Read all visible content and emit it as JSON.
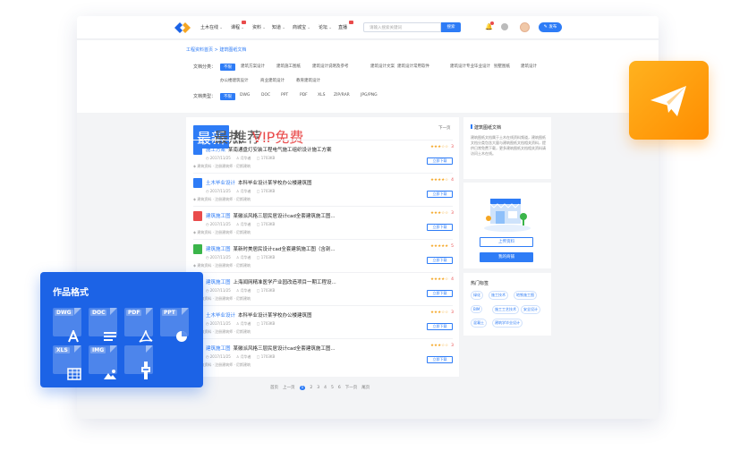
{
  "nav": {
    "items": [
      {
        "label": "土木在线",
        "chev": "⌄"
      },
      {
        "label": "课程",
        "chev": "⌄",
        "badge": true
      },
      {
        "label": "资料",
        "chev": "⌄"
      },
      {
        "label": "知道",
        "chev": "⌄"
      },
      {
        "label": "商城宝",
        "chev": "⌄"
      },
      {
        "label": "论坛",
        "chev": "⌄"
      },
      {
        "label": "直播",
        "chev": "",
        "badge": true
      }
    ],
    "search_placeholder": "请输入搜索关键词",
    "search_button": "搜索",
    "publish_label": "发布"
  },
  "breadcrumb": "工程资料首页 > 建筑图纸文档",
  "filter": {
    "category_label": "文档分类：",
    "categories": [
      "不限",
      "建筑方案设计",
      "建筑施工图纸",
      "建筑设计说明及参考",
      "建筑设计文案",
      "建筑设计常用软件",
      "建筑设计专业毕业设计",
      "别墅图纸",
      "建筑设计",
      "办公楼建筑设计",
      "商业建筑设计",
      "教育建筑设计"
    ],
    "type_label": "文档类型：",
    "types": [
      "不限",
      "DWG",
      "DOC",
      "PPT",
      "PDF",
      "XLS",
      "ZIP/RAR",
      "JPG/PNG"
    ]
  },
  "list": {
    "tabs": [
      "最新",
      "最热",
      "推荐",
      "VIP免费"
    ],
    "next_page": "下一页",
    "rows": [
      {
        "cat": "施工方案",
        "title": "某南通盘灯安装工程电气施工组织设计施工方案",
        "date": "2017/11/25",
        "author": "月华者",
        "size": "1703KB",
        "tags": "建筑资料 · 注册建筑师 · 尼斯建筑",
        "stars": "★★★☆☆",
        "score": "3",
        "icon_color": "#2e7cf6",
        "download": "立即下载"
      },
      {
        "cat": "土木毕业设计",
        "title": "本科毕业设计某学校办公楼建筑图",
        "date": "2017/11/25",
        "author": "月华者",
        "size": "1703KB",
        "tags": "建筑资料 · 注册建筑师 · 尼斯建筑",
        "stars": "★★★★☆",
        "score": "4",
        "icon_color": "#2e7cf6",
        "download": "立即下载"
      },
      {
        "cat": "建筑施工图",
        "title": "某徽派风格三层民居设计cad全套建筑施工图...",
        "date": "2017/11/25",
        "author": "月华者",
        "size": "1703KB",
        "tags": "建筑资料 · 注册建筑师 · 尼斯建筑",
        "stars": "★★★☆☆",
        "score": "3",
        "icon_color": "#e94b4b",
        "download": "立即下载"
      },
      {
        "cat": "建筑施工图",
        "title": "某新时美居民设计cad全套建筑施工图（含剖...",
        "date": "2017/11/25",
        "author": "月华者",
        "size": "1703KB",
        "tags": "建筑资料 · 注册建筑师 · 尼斯建筑",
        "stars": "★★★★★",
        "score": "5",
        "icon_color": "#3bb54a",
        "download": "立即下载"
      },
      {
        "cat": "建筑施工图",
        "title": "上海闻网精准医学产业园改造项目一期工程设...",
        "date": "2017/11/25",
        "author": "月华者",
        "size": "1703KB",
        "tags": "建筑资料 · 注册建筑师 · 尼斯建筑",
        "stars": "★★★★☆",
        "score": "4",
        "icon_color": "#2e7cf6",
        "download": "立即下载"
      },
      {
        "cat": "土木毕业设计",
        "title": "本科毕业设计某学校办公楼建筑图",
        "date": "2017/11/25",
        "author": "月华者",
        "size": "1703KB",
        "tags": "建筑资料 · 注册建筑师 · 尼斯建筑",
        "stars": "★★★☆☆",
        "score": "3",
        "icon_color": "#2e7cf6",
        "download": "立即下载"
      },
      {
        "cat": "建筑施工图",
        "title": "某徽派风格三层民居设计cad全套建筑施工图...",
        "date": "2017/11/25",
        "author": "月华者",
        "size": "1703KB",
        "tags": "建筑资料 · 注册建筑师 · 尼斯建筑",
        "stars": "★★★☆☆",
        "score": "3",
        "icon_color": "#2e7cf6",
        "download": "立即下载"
      }
    ]
  },
  "pager": {
    "prev_first": "首页",
    "prev": "上一页",
    "pages": [
      "1",
      "2",
      "3",
      "4",
      "5",
      "6"
    ],
    "current": "1",
    "next": "下一页",
    "last": "尾页"
  },
  "sidebar": {
    "intro_title": "建筑图纸文档",
    "intro_desc": "建筑图纸文档属于土木在线资料频道，建筑图纸文档分类包含大量与建筑图纸文档相关资料，提供日常免费下载，更多建筑图纸文档相关资料请访问土木在线。",
    "upload_label": "上传资料",
    "mystore_label": "我的商铺",
    "hot_title": "热门标签",
    "hot_tags": [
      "绿化",
      "施工技术",
      "地铁施工图",
      "BIM",
      "施工工艺技术",
      "安全设计",
      "混凝土",
      "建筑学毕业设计"
    ]
  },
  "formats_panel": {
    "title": "作品格式",
    "formats": [
      {
        "label": "DWG",
        "glyph": "dwg-icon"
      },
      {
        "label": "DOC",
        "glyph": "doc-icon"
      },
      {
        "label": "PDF",
        "glyph": "pdf-icon"
      },
      {
        "label": "PPT",
        "glyph": "ppt-icon"
      },
      {
        "label": "XLS",
        "glyph": "xls-icon"
      },
      {
        "label": "IMG",
        "glyph": "img-icon"
      },
      {
        "label": "",
        "glyph": "zip-icon"
      }
    ]
  },
  "colors": {
    "accent": "#2e7cf6",
    "panel_blue": "#1c63e6",
    "orange": "#ff9a0a",
    "star": "#f5a623"
  }
}
